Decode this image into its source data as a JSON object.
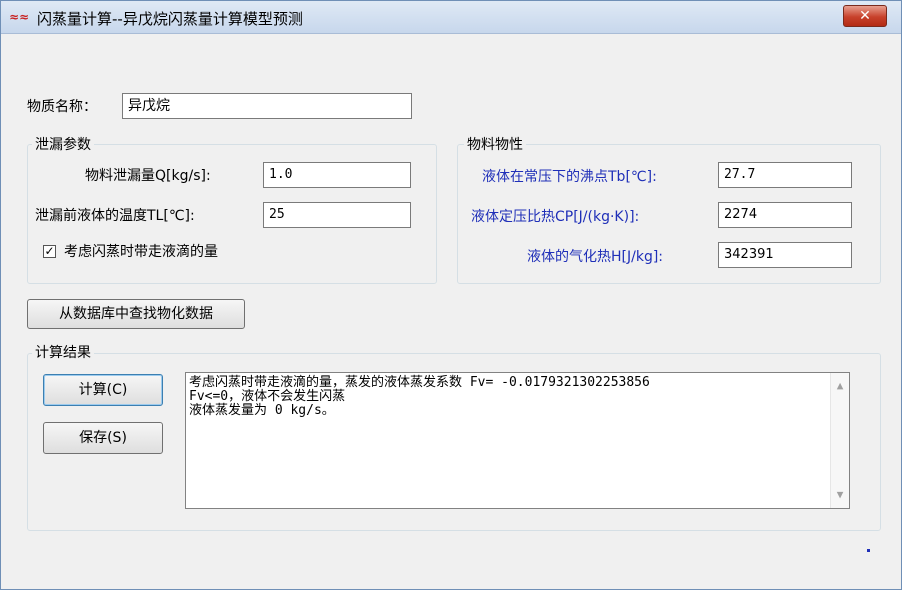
{
  "window": {
    "title": "闪蒸量计算--异戊烷闪蒸量计算模型预测",
    "icon": "app-logo-icon",
    "close_symbol": "✕"
  },
  "substance": {
    "label": "物质名称：",
    "value": "异戊烷"
  },
  "leak_params": {
    "title": "泄漏参数",
    "leak_rate_label": "物料泄漏量Q[kg/s]:",
    "leak_rate_value": "1.0",
    "liquid_temp_label": "泄漏前液体的温度TL[℃]:",
    "liquid_temp_value": "25",
    "consider_droplets_label": "考虑闪蒸时带走液滴的量",
    "consider_droplets_checked": true
  },
  "material_props": {
    "title": "物料物性",
    "boiling_point_label": "液体在常压下的沸点Tb[℃]:",
    "boiling_point_value": "27.7",
    "heat_capacity_label": "液体定压比热CP[J/(kg·K)]:",
    "heat_capacity_value": "2274",
    "vaporization_heat_label": "液体的气化热H[J/kg]:",
    "vaporization_heat_value": "342391"
  },
  "lookup_button": "从数据库中查找物化数据",
  "results": {
    "title": "计算结果",
    "calc_button": "计算(C)",
    "save_button": "保存(S)",
    "lines": [
      "考虑闪蒸时带走液滴的量，蒸发的液体蒸发系数 Fv= -0.0179321302253856",
      "Fv<=0，液体不会发生闪蒸",
      "液体蒸发量为 0 kg/s。"
    ]
  },
  "colors": {
    "accent_label": "#1f2fb8",
    "close_button": "#c7412b"
  }
}
